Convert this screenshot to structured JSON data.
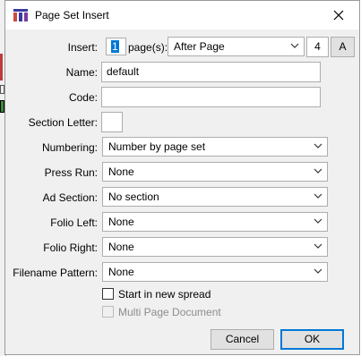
{
  "window": {
    "title": "Page Set Insert",
    "icon": "app-grid-icon",
    "close_icon": "close-icon"
  },
  "form": {
    "insert": {
      "label": "Insert:",
      "value": "1",
      "pages_label": "page(s):",
      "position": "After Page",
      "page_number": "4",
      "page_letter": "A"
    },
    "name": {
      "label": "Name:",
      "value": "default"
    },
    "code": {
      "label": "Code:",
      "value": ""
    },
    "section_letter": {
      "label": "Section Letter:",
      "value": ""
    },
    "numbering": {
      "label": "Numbering:",
      "value": "Number by page set"
    },
    "press_run": {
      "label": "Press Run:",
      "value": "None"
    },
    "ad_section": {
      "label": "Ad Section:",
      "value": "No section"
    },
    "folio_left": {
      "label": "Folio Left:",
      "value": "None"
    },
    "folio_right": {
      "label": "Folio Right:",
      "value": "None"
    },
    "filename_pattern": {
      "label": "Filename Pattern:",
      "value": "None"
    }
  },
  "options": {
    "start_new_spread": {
      "label": "Start in new spread",
      "checked": false
    },
    "multi_page_document": {
      "label": "Multi Page Document",
      "checked": false,
      "disabled": true
    }
  },
  "buttons": {
    "cancel": "Cancel",
    "ok": "OK"
  },
  "colors": {
    "accent": "#0078d7",
    "dialog_bg": "#f0f0f0"
  }
}
